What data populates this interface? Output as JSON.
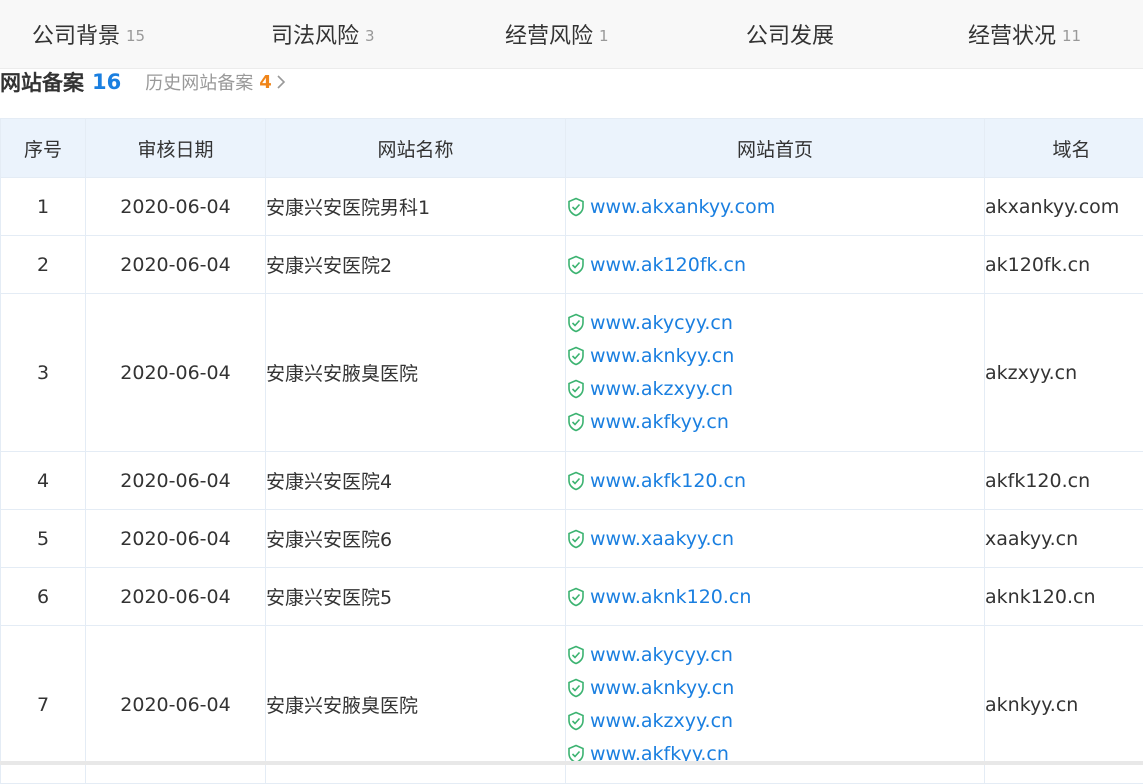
{
  "tabs": [
    {
      "label": "公司背景",
      "count": "15"
    },
    {
      "label": "司法风险",
      "count": "3"
    },
    {
      "label": "经营风险",
      "count": "1"
    },
    {
      "label": "公司发展",
      "count": ""
    },
    {
      "label": "经营状况",
      "count": "11"
    }
  ],
  "section": {
    "title": "网站备案",
    "count": "16",
    "history_label": "历史网站备案",
    "history_count": "4"
  },
  "table": {
    "headers": [
      "序号",
      "审核日期",
      "网站名称",
      "网站首页",
      "域名"
    ],
    "rows": [
      {
        "index": "1",
        "date": "2020-06-04",
        "name": "安康兴安医院男科1",
        "homepages": [
          "www.akxankyy.com"
        ],
        "domain": "akxankyy.com"
      },
      {
        "index": "2",
        "date": "2020-06-04",
        "name": "安康兴安医院2",
        "homepages": [
          "www.ak120fk.cn"
        ],
        "domain": "ak120fk.cn"
      },
      {
        "index": "3",
        "date": "2020-06-04",
        "name": "安康兴安腋臭医院",
        "homepages": [
          "www.akycyy.cn",
          "www.aknkyy.cn",
          "www.akzxyy.cn",
          "www.akfkyy.cn"
        ],
        "domain": "akzxyy.cn"
      },
      {
        "index": "4",
        "date": "2020-06-04",
        "name": "安康兴安医院4",
        "homepages": [
          "www.akfk120.cn"
        ],
        "domain": "akfk120.cn"
      },
      {
        "index": "5",
        "date": "2020-06-04",
        "name": "安康兴安医院6",
        "homepages": [
          "www.xaakyy.cn"
        ],
        "domain": "xaakyy.cn"
      },
      {
        "index": "6",
        "date": "2020-06-04",
        "name": "安康兴安医院5",
        "homepages": [
          "www.aknk120.cn"
        ],
        "domain": "aknk120.cn"
      },
      {
        "index": "7",
        "date": "2020-06-04",
        "name": "安康兴安腋臭医院",
        "homepages": [
          "www.akycyy.cn",
          "www.aknkyy.cn",
          "www.akzxyy.cn",
          "www.akfkyy.cn"
        ],
        "domain": "aknkyy.cn"
      }
    ]
  },
  "icons": {
    "verified": "shield-check-icon",
    "chevron": "chevron-right-icon"
  },
  "colors": {
    "accent": "#1a7fe0",
    "history_count": "#f08519",
    "verified_green": "#3cb371",
    "header_bg": "#ebf3fc"
  }
}
